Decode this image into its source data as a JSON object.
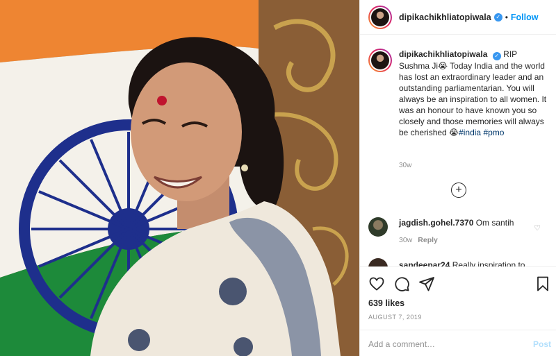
{
  "post": {
    "username": "dipikachikhliatopiwala",
    "follow_label": "Follow",
    "separator": "•",
    "verified_mark": "✓",
    "caption": {
      "username": "dipikachikhliatopiwala",
      "text_intro": "RIP Sushma Ji😭",
      "text_body": "Today India and the world has lost an extraordinary leader and an outstanding parliamentarian. You will always be an inspiration to all women. It was an honour to have known you so closely and those memories will always be cherished 😭",
      "hashtags": [
        "#india",
        "#pmo"
      ],
      "time": "30w"
    },
    "load_more_icon": "+",
    "comments": [
      {
        "username": "jagdish.gohel.7370",
        "text": "Om santih",
        "time": "30w",
        "reply_label": "Reply",
        "heart_icon": "♡"
      },
      {
        "username": "sandeepar24",
        "text": "Really inspiration to"
      }
    ],
    "likes": "639 likes",
    "date": "AUGUST 7, 2019",
    "comment_input_placeholder": "Add a comment…",
    "post_button_label": "Post"
  },
  "colors": {
    "accent": "#0095f6",
    "verified": "#3897f0",
    "muted": "#8e8e8e",
    "flag_saffron": "#ee8532",
    "flag_green": "#1d8a3a",
    "chakra_blue": "#1e2f8c"
  },
  "icons": [
    "heart-icon",
    "comment-icon",
    "share-icon",
    "bookmark-icon",
    "plus-circle-icon",
    "verified-badge-icon"
  ]
}
